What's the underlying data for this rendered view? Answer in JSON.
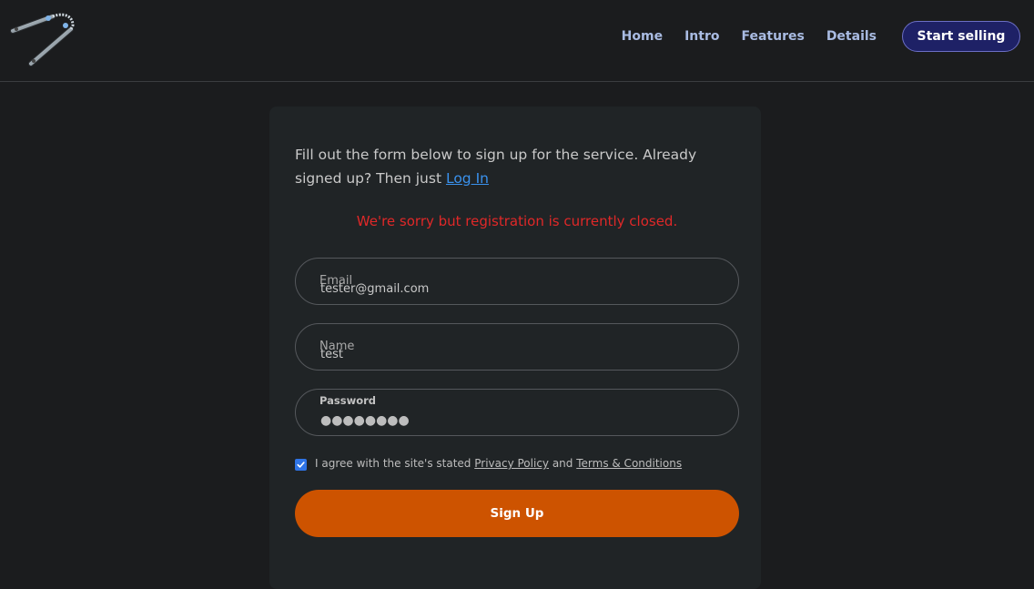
{
  "nav": {
    "items": [
      {
        "label": "Home"
      },
      {
        "label": "Intro"
      },
      {
        "label": "Features"
      },
      {
        "label": "Details"
      }
    ],
    "cta_label": "Start selling"
  },
  "form": {
    "intro_text": "Fill out the form below to sign up for the service. Already signed up? Then just ",
    "login_link": "Log In",
    "error_message": "We're sorry but registration is currently closed.",
    "email": {
      "label": "Email",
      "value": "tester@gmail.com"
    },
    "name": {
      "label": "Name",
      "value": "test"
    },
    "password": {
      "label": "Password",
      "value": "●●●●●●●●"
    },
    "agree": {
      "checked": true,
      "text_before": "I agree with the site's stated ",
      "privacy_link": "Privacy Policy",
      "text_and": " and ",
      "terms_link": "Terms & Conditions"
    },
    "submit_label": "Sign Up"
  },
  "colors": {
    "background": "#1b1c1e",
    "card": "#202426",
    "nav_link": "#a9bbe2",
    "cta_bg": "#1e2166",
    "error": "#e02828",
    "link": "#3a92ee",
    "submit_bg": "#cd5300",
    "checkbox": "#2f74e6"
  },
  "icons": {
    "logo": "silver-ornament-logo",
    "checkbox": "checkmark-icon"
  }
}
